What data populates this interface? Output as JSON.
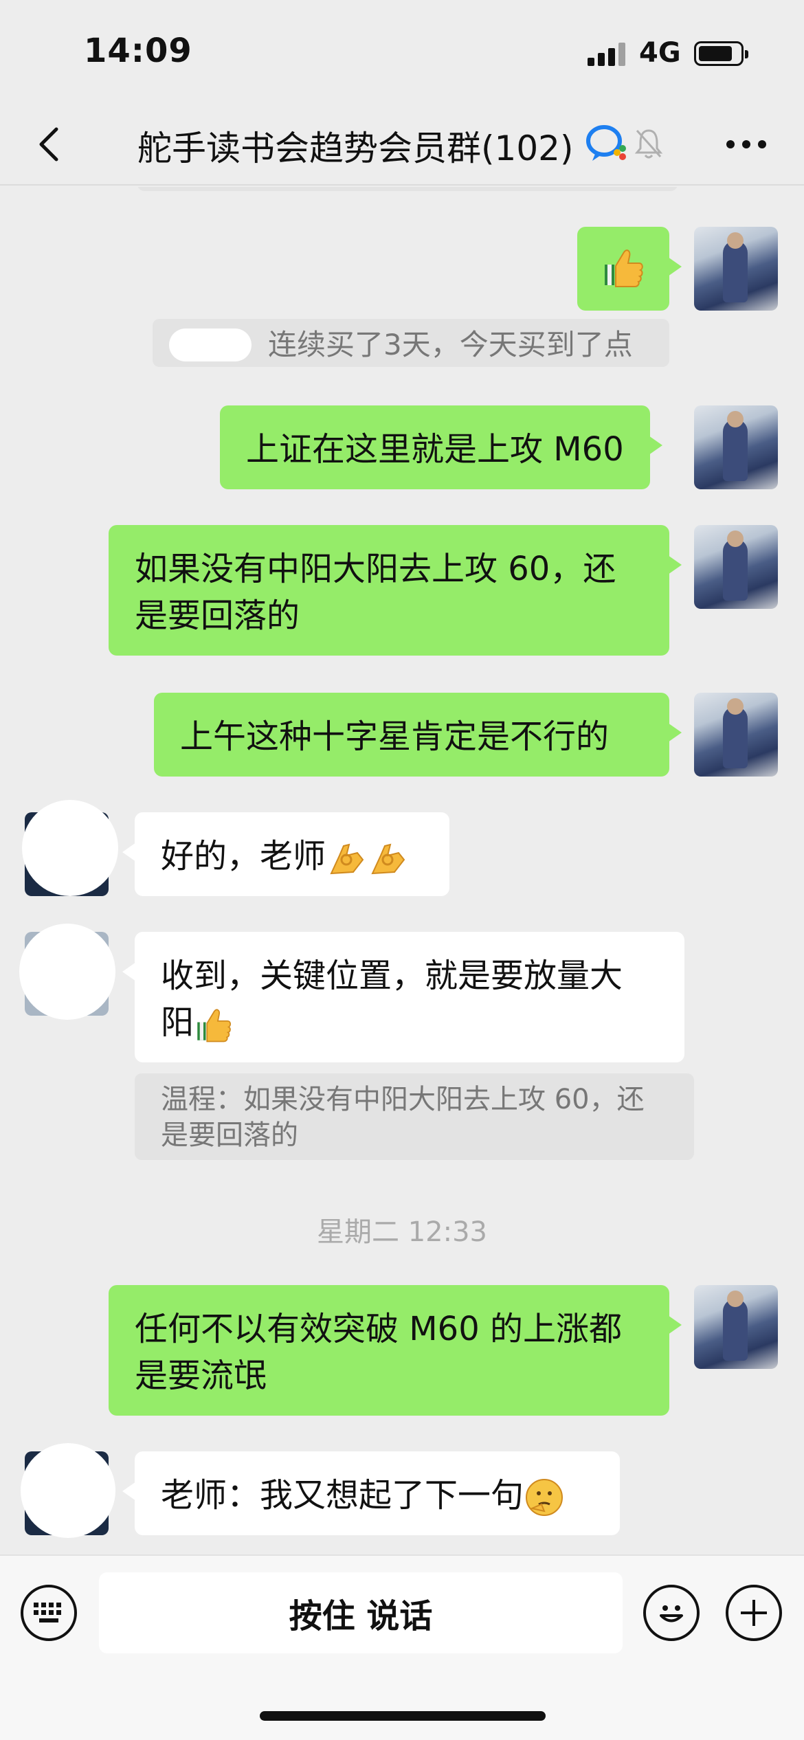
{
  "status_bar": {
    "time": "14:09",
    "network": "4G"
  },
  "nav": {
    "title": "舵手读书会趋势会员群(102)"
  },
  "messages": {
    "m1_text": "",
    "m2_quote": "连续买了3天，今天买到了点",
    "m3_text": "上证在这里就是上攻 M60",
    "m4_line1": "如果没有中阳大阳去上攻 60，还",
    "m4_line2": "是要回落的",
    "m5_text": "上午这种十字星肯定是不行的",
    "m6_text": "好的，老师",
    "m7_line1": "收到，关键位置，就是要放量大",
    "m7_line2": "阳",
    "m7_quote_line1": "温程：如果没有中阳大阳去上攻 60，还",
    "m7_quote_line2": "是要回落的",
    "timestamp": "星期二 12:33",
    "m8_line1": "任何不以有效突破 M60 的上涨都",
    "m8_line2": "是要流氓",
    "m9_text": "老师：我又想起了下一句"
  },
  "input_bar": {
    "voice_label": "按住 说话"
  },
  "icons": {
    "back": "chevron-left-icon",
    "more": "more-dots-icon",
    "enterprise": "wecom-icon",
    "mute": "muted-bell-icon",
    "keyboard": "keyboard-icon",
    "emoji": "emoji-smile-icon",
    "plus": "plus-icon"
  },
  "colors": {
    "green_bubble": "#95ec69",
    "background": "#ededed",
    "white_bubble": "#ffffff"
  }
}
